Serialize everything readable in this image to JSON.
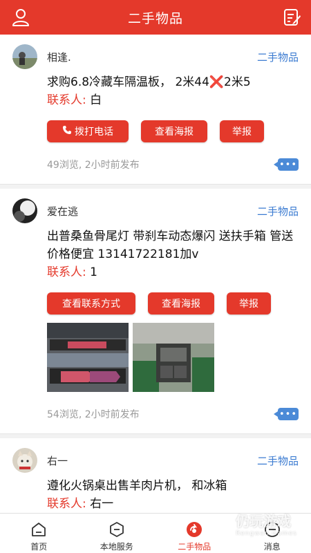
{
  "header": {
    "title": "二手物品"
  },
  "posts": [
    {
      "username": "相逢.",
      "category": "二手物品",
      "content": "求购6.8冷藏车隔温板， 2米44❌2米5",
      "contact_label": "联系人:",
      "contact_value": "白",
      "buttons": [
        "拨打电话",
        "查看海报",
        "举报"
      ],
      "stats": "49浏览, 2小时前发布"
    },
    {
      "username": "爱在逃",
      "category": "二手物品",
      "content": "出普桑鱼骨尾灯 带刹车动态爆闪 送扶手箱 管送 价格便宜 13141722181加v",
      "contact_label": "联系人:",
      "contact_value": "1",
      "buttons": [
        "查看联系方式",
        "查看海报",
        "举报"
      ],
      "stats": "54浏览, 2小时前发布"
    },
    {
      "username": "右一",
      "category": "二手物品",
      "content": "遵化火锅桌出售羊肉片机， 和冰箱",
      "contact_label": "联系人:",
      "contact_value": "右一"
    }
  ],
  "more_label": "•••",
  "tabs": [
    {
      "label": "首页",
      "icon": "home-icon"
    },
    {
      "label": "本地服务",
      "icon": "hexagon-icon"
    },
    {
      "label": "二手物品",
      "icon": "secondhand-icon"
    },
    {
      "label": "消息",
      "icon": "message-icon"
    }
  ],
  "watermark": {
    "main": "仍玩游戏",
    "sub": "Rengwan Games"
  },
  "colors": {
    "accent": "#e4392b",
    "link": "#3b7bd1"
  }
}
